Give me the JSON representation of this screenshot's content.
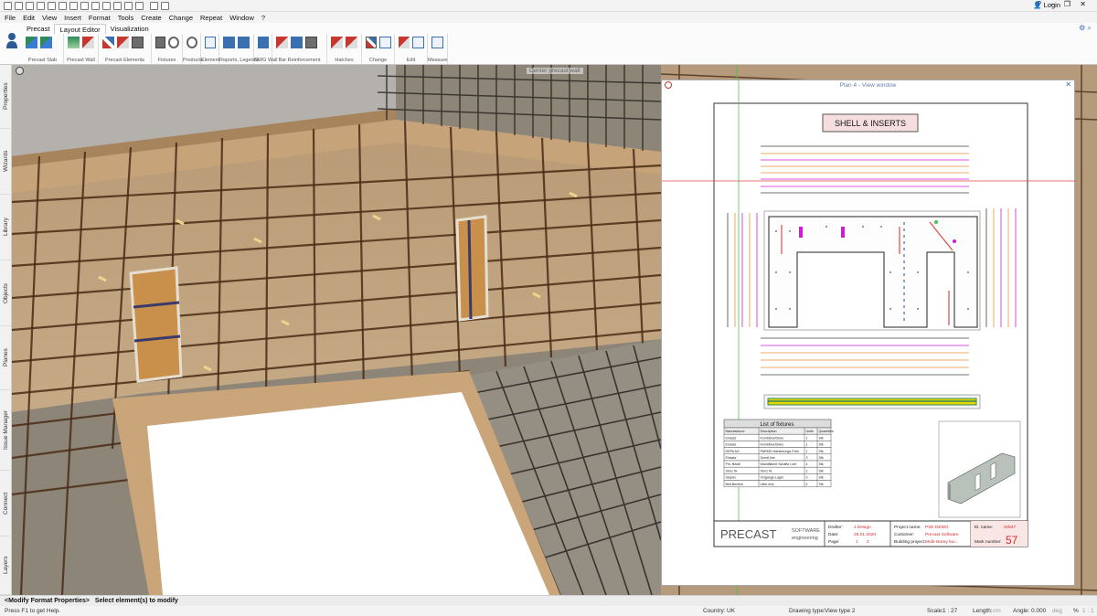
{
  "menu": [
    "File",
    "Edit",
    "View",
    "Insert",
    "Format",
    "Tools",
    "Create",
    "Change",
    "Repeat",
    "Window",
    "?"
  ],
  "login_label": "Login",
  "window_controls": "? – ❐ ✕",
  "ribbon": {
    "tabs": [
      "Precast",
      "Layout Editor",
      "Visualization"
    ],
    "active_tab": "Layout Editor",
    "groups": [
      "Precast Slab",
      "Precast Wall",
      "Precast Elements",
      "Fixtures",
      "Products",
      "Element",
      "Reports, Legends",
      "NWG Wall",
      "Bar Reinforcement",
      "Hatches",
      "Change",
      "Edit",
      "Measure"
    ]
  },
  "left_tabs": [
    "Properties",
    "Wizards",
    "Library",
    "Objects",
    "Planes",
    "Issue Manager",
    "Connect",
    "Layers"
  ],
  "viewport": {
    "cursor_label": "Center precast wall"
  },
  "plan_window": {
    "title": "Plan 4 - View window",
    "close": "✕",
    "heading": "SHELL & INSERTS",
    "fixtures_title": "List of fixtures",
    "fixture_headers": [
      "Manufacturer",
      "Description",
      "Units",
      "Quantities"
    ],
    "fixture_rows": [
      [
        "Einsatz",
        "Kombibox/Deko",
        "1",
        "Stk"
      ],
      [
        "Einsatz",
        "Kombibox/Deko",
        "1",
        "Stk"
      ],
      [
        "DEPA AG",
        "PARKEI Markierungs Folie",
        "1",
        "Stk"
      ],
      [
        "Einsatz",
        "Gurtel line",
        "3",
        "Stk"
      ],
      [
        "Pm. Betail",
        "Wandfläche Schalte Leer",
        "4",
        "Stk"
      ],
      [
        "Sturz fix",
        "Sturz fix",
        "2",
        "Stk"
      ],
      [
        "Stapler",
        "Vorgangs-Lager",
        "3",
        "Stk"
      ],
      [
        "Betr.Bereich",
        "Lifter Anh",
        "4",
        "Stk"
      ]
    ],
    "title_block": {
      "logo_main": "PRECAST",
      "logo_sub1": "SOFTWARE",
      "logo_sub2": "engineering",
      "drafter_label": "Drafter:",
      "drafter": "J.Design",
      "date_label": "Date:",
      "date": "26.01.2020",
      "page_label": "Page:",
      "page": "1",
      "page_of": "2",
      "project_label": "Project name:",
      "project": "PSE DEMO",
      "customer_label": "Customer:",
      "customer": "Precast Software",
      "building_label": "Building project:",
      "building": "Multi-storey bui...",
      "el_label": "El. name:",
      "el_name": "SW47",
      "mark_label": "Mark number:",
      "mark": "57"
    }
  },
  "status": {
    "mode": "<Modify Format Properties>",
    "prompt": "Select element(s) to modify",
    "help": "Press F1 to get Help.",
    "country_label": "Country:",
    "country": "UK",
    "drawing_label": "Drawing type:",
    "drawing": "View type 2",
    "scale_label": "Scale:",
    "scale": "1 : 27",
    "length_label": "Length:",
    "length_unit": "cm",
    "angle_label": "Angle:",
    "angle": "0.000",
    "angle_unit": "deg",
    "pct": "%",
    "zoom": "1 : 1"
  },
  "colors": {
    "accent": "#3a6fb0",
    "red": "#c7362f",
    "magenta": "#d21bd0",
    "orange": "#e8923a",
    "concrete": "#c9b48f"
  }
}
